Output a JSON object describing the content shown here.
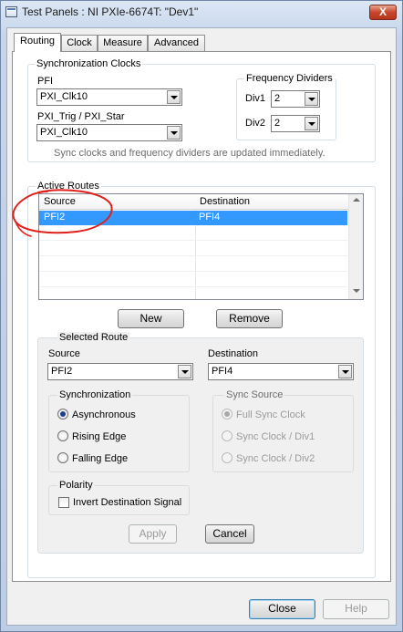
{
  "window": {
    "title": "Test Panels : NI PXIe-6674T: \"Dev1\"",
    "close_glyph": "X"
  },
  "tabs": [
    {
      "label": "Routing",
      "active": true
    },
    {
      "label": "Clock",
      "active": false
    },
    {
      "label": "Measure",
      "active": false
    },
    {
      "label": "Advanced",
      "active": false
    }
  ],
  "sync_clocks": {
    "group_label": "Synchronization Clocks",
    "pfi_label": "PFI",
    "pfi_value": "PXI_Clk10",
    "pxitrig_label": "PXI_Trig / PXI_Star",
    "pxitrig_value": "PXI_Clk10",
    "freq_group_label": "Frequency Dividers",
    "div1_label": "Div1",
    "div1_value": "2",
    "div2_label": "Div2",
    "div2_value": "2",
    "hint": "Sync clocks and frequency dividers are updated immediately."
  },
  "active_routes": {
    "group_label": "Active Routes",
    "columns": [
      "Source",
      "Destination"
    ],
    "rows": [
      {
        "source": "PFI2",
        "destination": "PFI4",
        "selected": true
      }
    ],
    "new_label": "New",
    "remove_label": "Remove"
  },
  "selected_route": {
    "group_label": "Selected Route",
    "source_label": "Source",
    "source_value": "PFI2",
    "destination_label": "Destination",
    "destination_value": "PFI4",
    "sync_group_label": "Synchronization",
    "sync_options": [
      {
        "label": "Asynchronous",
        "selected": true
      },
      {
        "label": "Rising Edge",
        "selected": false
      },
      {
        "label": "Falling Edge",
        "selected": false
      }
    ],
    "syncsrc_group_label": "Sync Source",
    "syncsrc_options": [
      {
        "label": "Full Sync Clock",
        "selected": true
      },
      {
        "label": "Sync Clock / Div1",
        "selected": false
      },
      {
        "label": "Sync Clock / Div2",
        "selected": false
      }
    ],
    "polarity_group_label": "Polarity",
    "invert_label": "Invert Destination Signal",
    "apply_label": "Apply",
    "cancel_label": "Cancel"
  },
  "footer": {
    "close_label": "Close",
    "help_label": "Help"
  },
  "colors": {
    "selection": "#3399ff",
    "annotation": "#e0201a",
    "title_bar": "#c5d5ea"
  }
}
